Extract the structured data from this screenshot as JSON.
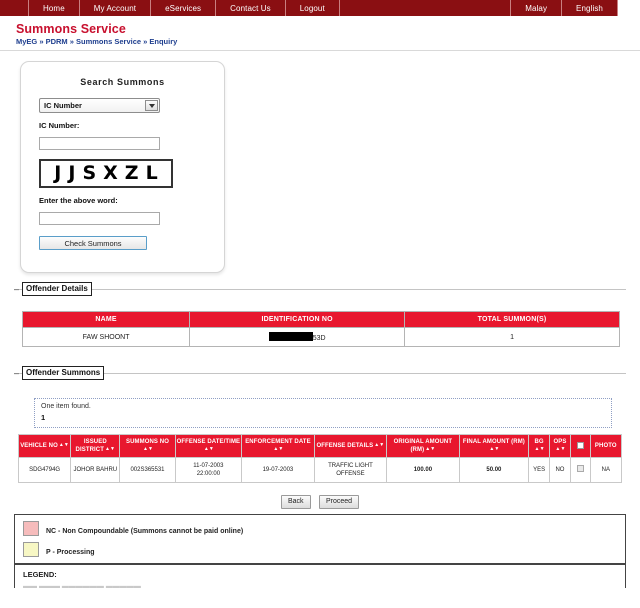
{
  "nav": {
    "items": [
      "Home",
      "My Account",
      "eServices",
      "Contact Us",
      "Logout"
    ],
    "languages": [
      "Malay",
      "English"
    ]
  },
  "header": {
    "title": "Summons Service",
    "breadcrumb": "MyEG » PDRM » Summons Service » Enquiry"
  },
  "search": {
    "title": "Search Summons",
    "select_value": "IC Number",
    "ic_label": "IC Number:",
    "ic_value": "",
    "captcha_letters": [
      "J",
      "J",
      "S",
      "X",
      "Z",
      "L"
    ],
    "captcha_label": "Enter the above word:",
    "captcha_value": "",
    "submit_label": "Check Summons"
  },
  "offender_details": {
    "legend": "Offender Details",
    "headers": [
      "NAME",
      "IDENTIFICATION NO",
      "TOTAL SUMMON(S)"
    ],
    "row": {
      "name": "FAW SHOONT",
      "identification_no": "53D",
      "total_summons": "1"
    }
  },
  "offender_summons": {
    "legend": "Offender Summons",
    "found_text": "One item found.",
    "page_number": "1",
    "headers": [
      "VEHICLE NO",
      "ISSUED DISTRICT",
      "SUMMONS NO",
      "OFFENSE DATE/TIME",
      "ENFORCEMENT DATE",
      "OFFENSE DETAILS",
      "ORIGINAL AMOUNT (RM)",
      "FINAL AMOUNT (RM)",
      "BG",
      "OPS",
      "",
      "PHOTO"
    ],
    "rows": [
      {
        "vehicle_no": "SDG4794G",
        "issued_district": "JOHOR BAHRU",
        "summons_no": "002S365531",
        "offense_date": "11-07-2003",
        "offense_time": "22:00:00",
        "enforcement_date": "19-07-2003",
        "offense_details": "TRAFFIC LIGHT OFFENSE",
        "original_amount": "100.00",
        "final_amount": "50.00",
        "bg": "YES",
        "ops": "NO",
        "photo": "NA"
      }
    ],
    "buttons": {
      "back": "Back",
      "proceed": "Proceed"
    }
  },
  "legend_panel": {
    "nc_text": "NC - Non Compoundable (Summons cannot be paid online)",
    "p_text": "P - Processing",
    "nc_color": "#f6bcbc",
    "p_color": "#f7f7c4"
  },
  "legend_panel2": {
    "title": "LEGEND:"
  },
  "colors": {
    "nav_bg": "#8a0f12",
    "title_red": "#c8102e",
    "table_header_red": "#e8172e",
    "breadcrumb_blue": "#1f3f8f"
  }
}
